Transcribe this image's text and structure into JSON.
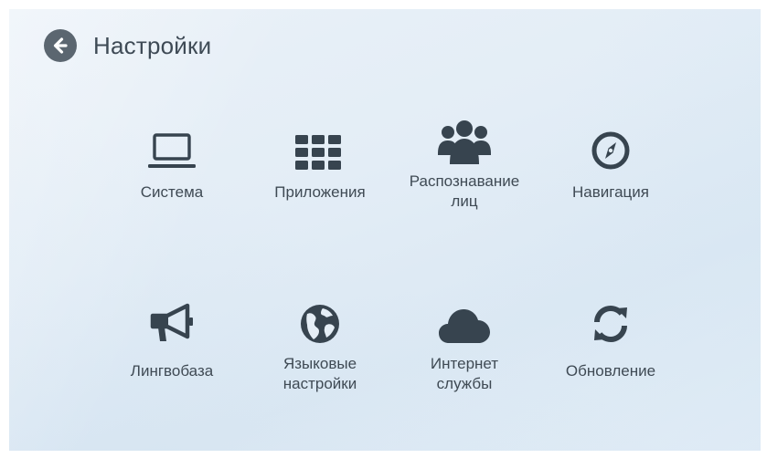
{
  "header": {
    "title": "Настройки",
    "back_icon": "arrow-left-circle-icon"
  },
  "colors": {
    "icon": "#37444f",
    "text": "#3f4a54",
    "back_button": "#5b6670"
  },
  "tiles": [
    {
      "id": "system",
      "label": "Система",
      "icon": "laptop-icon"
    },
    {
      "id": "apps",
      "label": "Приложения",
      "icon": "grid-icon"
    },
    {
      "id": "face-recognition",
      "label": "Распознавание\nлиц",
      "icon": "users-icon"
    },
    {
      "id": "navigation",
      "label": "Навигация",
      "icon": "compass-icon"
    },
    {
      "id": "lingvobase",
      "label": "Лингвобаза",
      "icon": "bullhorn-icon"
    },
    {
      "id": "language",
      "label": "Языковые\nнастройки",
      "icon": "globe-icon"
    },
    {
      "id": "internet",
      "label": "Интернет\nслужбы",
      "icon": "cloud-icon"
    },
    {
      "id": "update",
      "label": "Обновление",
      "icon": "refresh-icon"
    }
  ]
}
